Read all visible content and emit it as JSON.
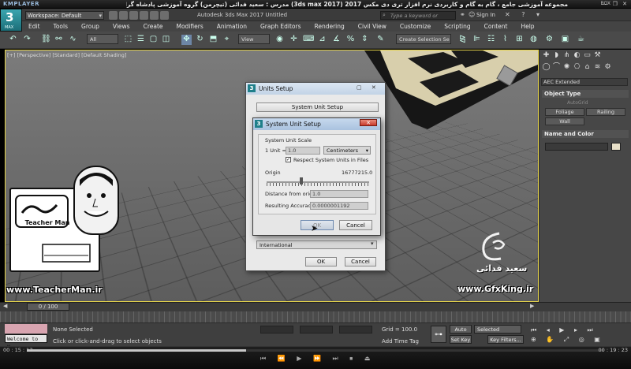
{
  "player": {
    "logo": "KMPLAYER",
    "title": "مجموعه آموزشی جامع ، گام به گام و کاربردی نرم افزار تری دی مکس 2017 (3ds max 2017) مدرس : سعید فدائی (تیچرمن) گروه آموزشی پادشاه گرافیست ها",
    "corner_label": "BOX",
    "time_elapsed": "00 : 15 : 17",
    "time_total": "00 : 19 : 23",
    "progress_fraction": 0.38
  },
  "max": {
    "logo_text": "3",
    "logo_sub": "MAX",
    "workspace": "Workspace: Default",
    "app_title": "Autodesk 3ds Max 2017    Untitled",
    "search_placeholder": "Type a keyword or phrase",
    "sign_in": "Sign In"
  },
  "menu": [
    "Edit",
    "Tools",
    "Group",
    "Views",
    "Create",
    "Modifiers",
    "Animation",
    "Graph Editors",
    "Rendering",
    "Civil View",
    "Customize",
    "Scripting",
    "Content",
    "Help"
  ],
  "toolbar": {
    "filter": "All",
    "refcoord": "View",
    "selection_set": "Create Selection Se"
  },
  "viewport": {
    "label": "[+] [Perspective] [Standard] [Default Shading]"
  },
  "overlay": {
    "teacher_name": "Teacher Man",
    "teacher_url": "www.TeacherMan.ir",
    "gfx_name": "سعید فدائی",
    "gfx_url": "www.GfxKing.ir"
  },
  "command_panel": {
    "category": "AEC Extended",
    "object_type_header": "Object Type",
    "autogrid": "AutoGrid",
    "buttons": [
      "Foliage",
      "Railing",
      "Wall"
    ],
    "name_color_header": "Name and Color"
  },
  "units_setup": {
    "title": "Units Setup",
    "system_unit_button": "System Unit Setup",
    "lighting_units": "International",
    "ok": "OK",
    "cancel": "Cancel"
  },
  "system_unit_setup": {
    "title": "System Unit Setup",
    "group_label": "System Unit Scale",
    "unit_prefix": "1 Unit =",
    "unit_value": "1.0",
    "unit_type": "Centimeters",
    "respect_label": "Respect System Units in Files",
    "respect_checked": "✓",
    "origin_label": "Origin",
    "origin_value": "16777215.0",
    "distance_label": "Distance from origin:",
    "distance_value": "1.0",
    "accuracy_label": "Resulting Accuracy:",
    "accuracy_value": "0.0000001192",
    "ok": "OK",
    "cancel": "Cancel"
  },
  "timeline": {
    "frame_display": "0 / 100"
  },
  "status": {
    "maxscript": "Welcome to M.",
    "selection": "None Selected",
    "hint": "Click or click-and-drag to select objects",
    "grid": "Grid = 100.0",
    "time_tag": "Add Time Tag",
    "auto_key": "Auto Key",
    "set_key": "Set Key",
    "selected": "Selected",
    "key_filters": "Key Filters..."
  }
}
